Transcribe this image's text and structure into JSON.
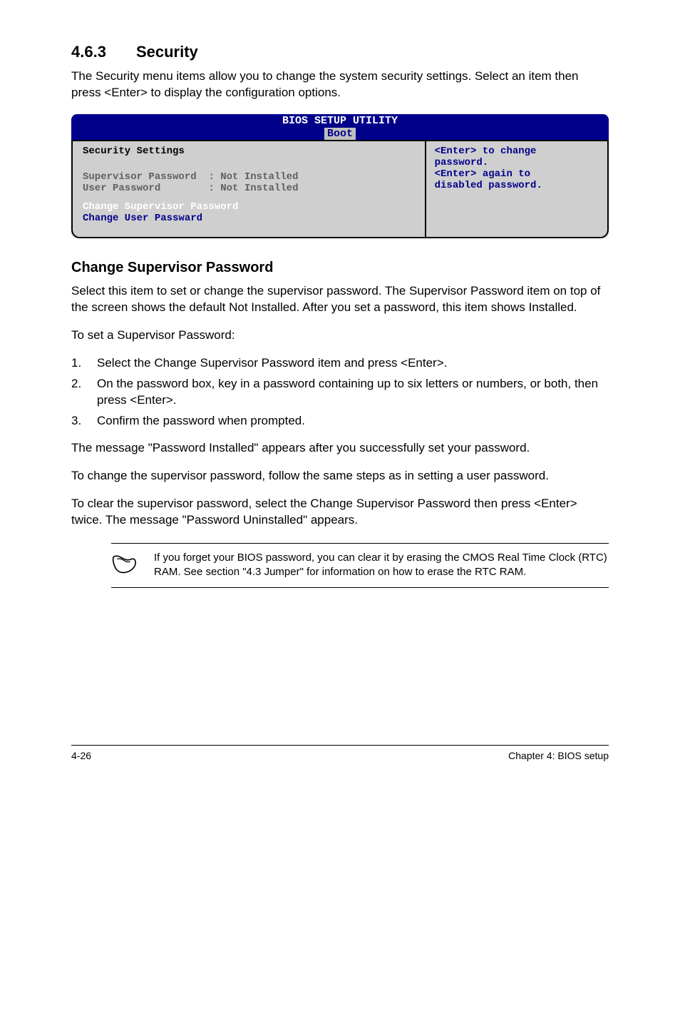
{
  "section": {
    "number": "4.6.3",
    "title": "Security"
  },
  "intro": "The Security menu items allow you to change the system security settings. Select an item then press <Enter> to display the configuration options.",
  "bios": {
    "title": "BIOS SETUP UTILITY",
    "tab": "Boot",
    "left": {
      "heading": "Security Settings",
      "rows": [
        {
          "label": "Supervisor Password",
          "value": ": Not Installed",
          "cls": "bios-gray"
        },
        {
          "label": "User Password      ",
          "value": ": Not Installed",
          "cls": "bios-gray"
        }
      ],
      "actions": [
        {
          "text": "Change Supervisor Password",
          "cls": "bios-white"
        },
        {
          "text": "Change User Passward",
          "cls": "bios-blue"
        }
      ]
    },
    "right": {
      "lines": [
        "<Enter> to change",
        "password.",
        "<Enter> again to",
        "disabled password."
      ]
    }
  },
  "subheading": "Change Supervisor Password",
  "para1": "Select this item to set or change the supervisor password. The Supervisor Password item on top of the screen shows the default Not Installed. After you set a password, this item shows Installed.",
  "para2": "To set a Supervisor Password:",
  "steps": [
    "Select the Change Supervisor Password item and press <Enter>.",
    "On the password box, key in a password containing up to six letters or numbers, or both, then press <Enter>.",
    "Confirm the password when prompted."
  ],
  "para3": "The message \"Password Installed\" appears after you successfully set your password.",
  "para4": "To change the supervisor password, follow the same steps as in setting a user password.",
  "para5": "To clear the supervisor password, select the Change Supervisor Password then press <Enter> twice. The message \"Password Uninstalled\" appears.",
  "note": "If you forget your BIOS password, you can clear it by erasing the CMOS Real Time Clock (RTC) RAM. See section \"4.3 Jumper\" for information on how to erase the RTC RAM.",
  "footer": {
    "left": "4-26",
    "right": "Chapter 4: BIOS setup"
  }
}
